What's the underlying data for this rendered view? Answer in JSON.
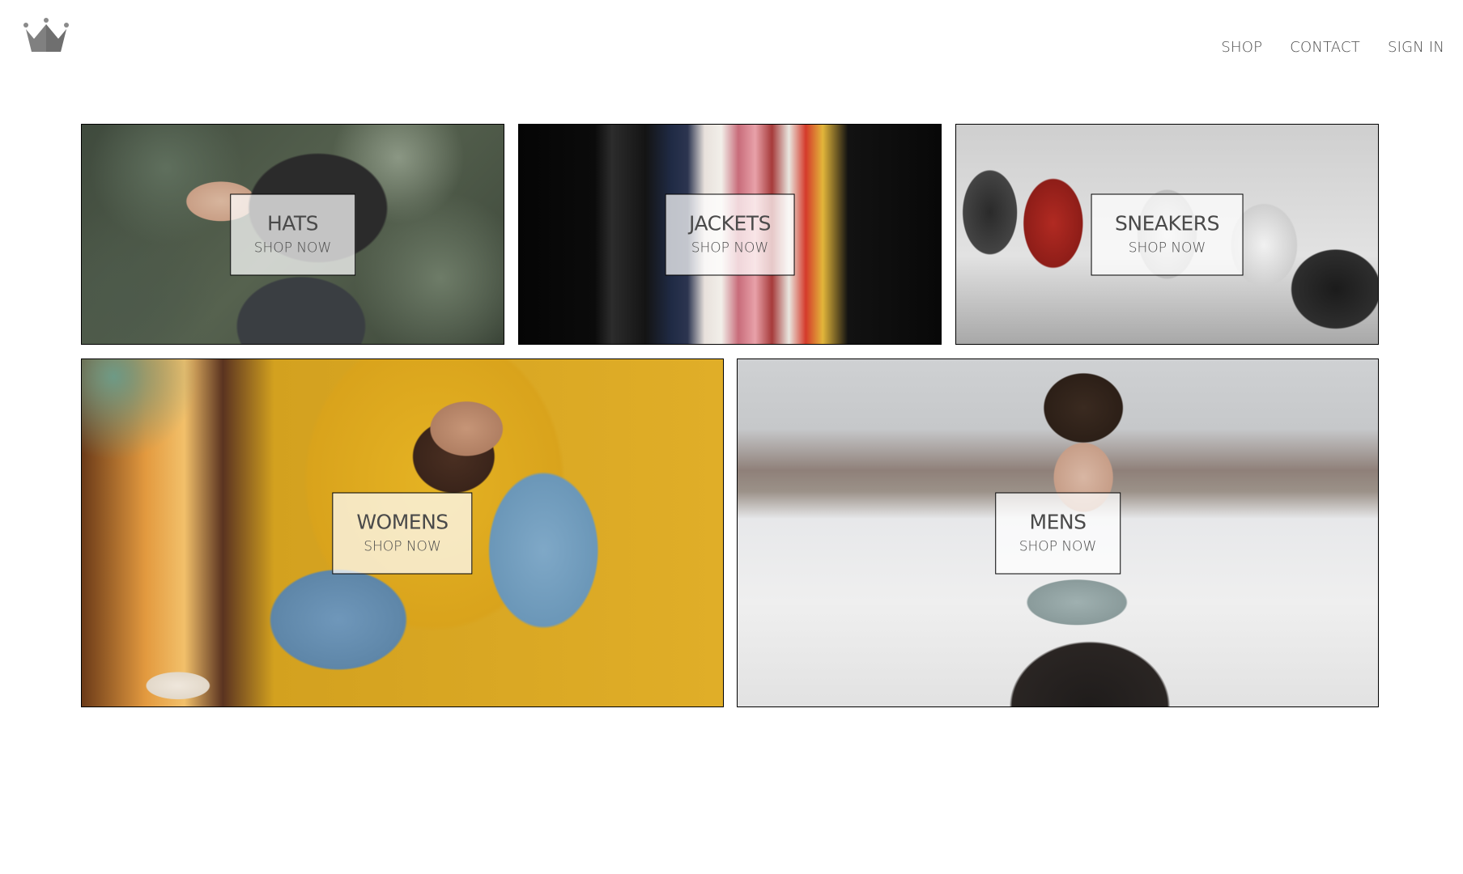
{
  "header": {
    "logo_icon": "crown-icon",
    "nav": [
      {
        "label": "SHOP"
      },
      {
        "label": "CONTACT"
      },
      {
        "label": "SIGN IN"
      }
    ]
  },
  "directory": [
    {
      "title": "HATS",
      "subtitle": "SHOP NOW",
      "image": "man-wearing-cap-photo"
    },
    {
      "title": "JACKETS",
      "subtitle": "SHOP NOW",
      "image": "jackets-on-rack-photo"
    },
    {
      "title": "SNEAKERS",
      "subtitle": "SHOP NOW",
      "image": "row-of-sneakers-photo"
    },
    {
      "title": "WOMENS",
      "subtitle": "SHOP NOW",
      "image": "woman-in-denim-on-yellow-chair-photo"
    },
    {
      "title": "MENS",
      "subtitle": "SHOP NOW",
      "image": "man-with-scarf-in-snow-photo"
    }
  ],
  "colors": {
    "text": "#4a4a4a",
    "border": "#000000",
    "overlay": "#ffffff"
  }
}
